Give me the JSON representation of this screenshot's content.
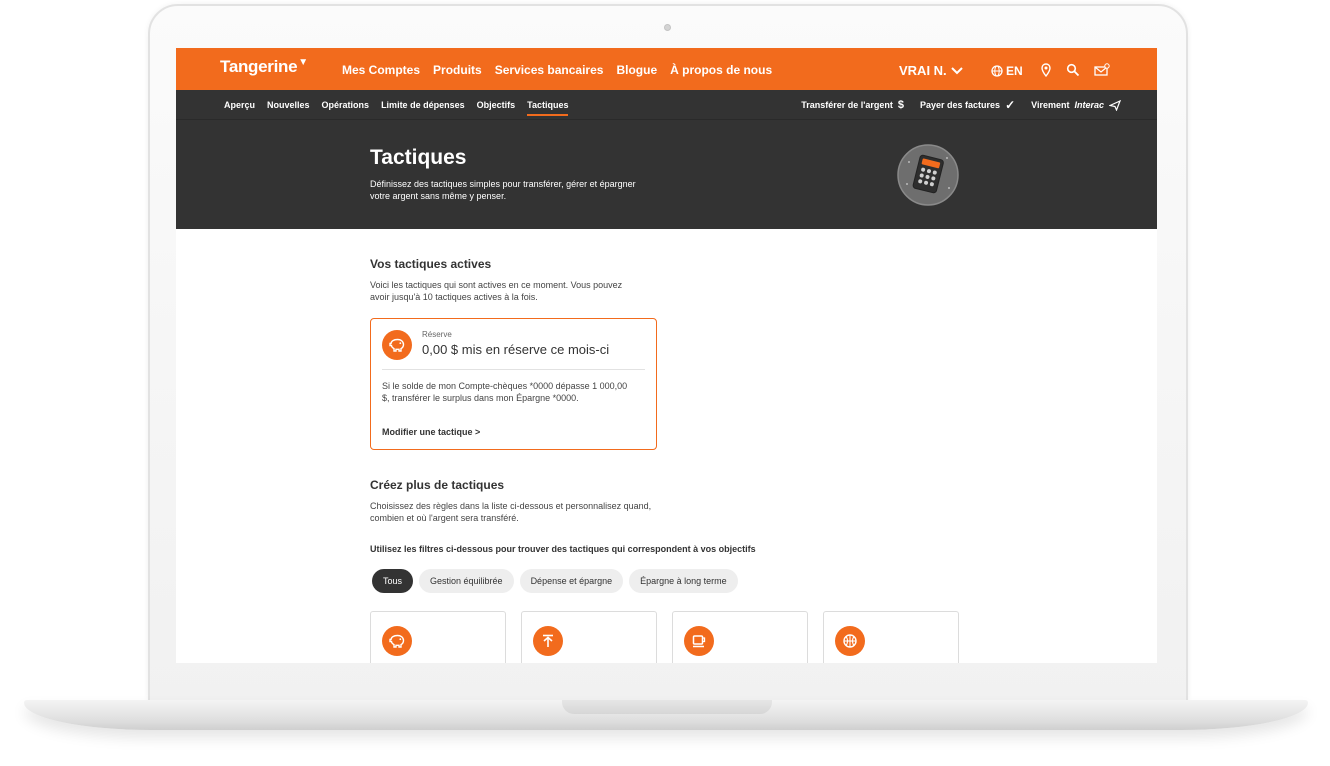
{
  "brand": {
    "logo": "Tangerine",
    "logo_mark": "▼",
    "accent": "#f26b1d",
    "dark": "#333333"
  },
  "topnav": {
    "items": [
      "Mes Comptes",
      "Produits",
      "Services bancaires",
      "Blogue",
      "À propos de nous"
    ],
    "user": "VRAI N.",
    "lang": "EN",
    "icons": [
      "globe-icon",
      "location-pin-icon",
      "search-icon",
      "mail-icon"
    ]
  },
  "subnav": {
    "items": [
      "Aperçu",
      "Nouvelles",
      "Opérations",
      "Limite de dépenses",
      "Objectifs",
      "Tactiques"
    ],
    "active": "Tactiques",
    "actions": [
      {
        "label": "Transférer de l'argent",
        "icon": "dollar-icon"
      },
      {
        "label": "Payer des factures",
        "icon": "checkmark-icon"
      },
      {
        "label": "Virement",
        "label_italic": "Interac",
        "icon": "send-icon"
      }
    ]
  },
  "hero": {
    "title": "Tactiques",
    "subtitle": "Définissez des tactiques simples pour transférer, gérer et épargner votre argent sans même y penser.",
    "icon": "calculator-icon"
  },
  "active_section": {
    "title": "Vos tactiques actives",
    "description": "Voici les tactiques qui sont actives en ce moment. Vous pouvez avoir jusqu'à 10 tactiques actives à la fois."
  },
  "active_card": {
    "label": "Réserve",
    "amount": "0,00 $ mis en réserve ce mois-ci",
    "rule": "Si le solde de mon Compte-chèques *0000 dépasse 1 000,00 $, transférer le surplus dans mon Épargne *0000.",
    "link": "Modifier une tactique >",
    "icon": "piggy-bank-icon"
  },
  "create_section": {
    "title": "Créez plus de tactiques",
    "description": "Choisissez des règles dans la liste ci-dessous et personnalisez quand, combien et où l'argent sera transféré.",
    "filter_hint": "Utilisez les filtres ci-dessous pour trouver des tactiques qui correspondent à vos objectifs",
    "filters": [
      "Tous",
      "Gestion équilibrée",
      "Dépense et épargne",
      "Épargne à long terme"
    ],
    "selected_filter": "Tous"
  },
  "tiles": [
    {
      "icon": "piggy-bank-icon"
    },
    {
      "icon": "arrow-up-icon"
    },
    {
      "icon": "coffee-cup-icon"
    },
    {
      "icon": "basketball-icon"
    }
  ]
}
